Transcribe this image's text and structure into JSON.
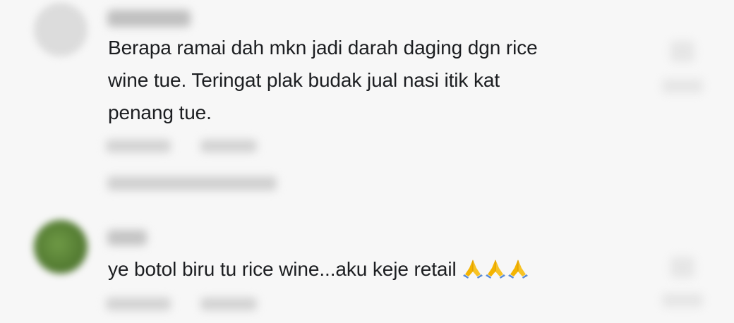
{
  "comments": [
    {
      "text_lines": [
        "Berapa ramai dah mkn jadi darah daging dgn rice",
        "wine tue. Teringat plak budak jual nasi itik kat",
        "penang tue."
      ],
      "avatar_color": "#dcdcdc"
    },
    {
      "text": "ye botol biru tu rice wine...aku keje retail",
      "emoji_icons": [
        "folded-hands-icon",
        "folded-hands-icon",
        "folded-hands-icon"
      ],
      "avatar_color": "#5a8238"
    }
  ],
  "colors": {
    "background": "#f7f7f7",
    "text": "#1c1e21"
  }
}
